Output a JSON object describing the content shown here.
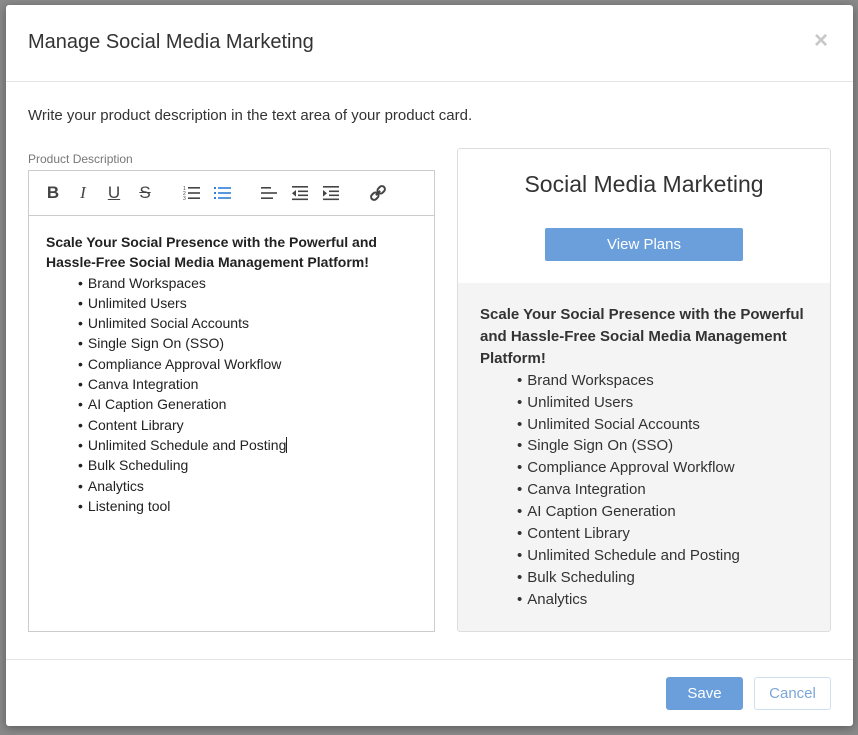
{
  "modal": {
    "title": "Manage Social Media Marketing",
    "close_glyph": "×",
    "intro": "Write your product description in the text area of your product card."
  },
  "editor": {
    "label": "Product Description",
    "toolbar": [
      {
        "name": "bold-button",
        "icon": "bold-icon",
        "glyph": "B"
      },
      {
        "name": "italic-button",
        "icon": "italic-icon",
        "glyph": "I"
      },
      {
        "name": "underline-button",
        "icon": "underline-icon",
        "glyph": "U"
      },
      {
        "name": "strikethrough-button",
        "icon": "strikethrough-icon",
        "glyph": "S"
      },
      {
        "name": "ordered-list-button",
        "icon": "ordered-list-icon"
      },
      {
        "name": "bullet-list-button",
        "icon": "bullet-list-icon",
        "active": true
      },
      {
        "name": "align-left-button",
        "icon": "align-left-icon"
      },
      {
        "name": "outdent-button",
        "icon": "outdent-icon"
      },
      {
        "name": "indent-button",
        "icon": "indent-icon"
      },
      {
        "name": "link-button",
        "icon": "link-icon"
      }
    ],
    "headline": "Scale Your Social Presence with the Powerful and Hassle-Free Social Media Management Platform!",
    "items": [
      "Brand Workspaces",
      "Unlimited Users",
      "Unlimited Social Accounts",
      "Single Sign On (SSO)",
      "Compliance Approval Workflow",
      "Canva Integration",
      "AI Caption Generation",
      "Content Library",
      "Unlimited Schedule and Posting",
      "Bulk Scheduling",
      "Analytics",
      "Listening tool"
    ]
  },
  "preview": {
    "title": "Social Media Marketing",
    "button_label": "View Plans",
    "headline": "Scale Your Social Presence with the Powerful and Hassle-Free Social Media Management Platform!",
    "items": [
      "Brand Workspaces",
      "Unlimited Users",
      "Unlimited Social Accounts",
      "Single Sign On (SSO)",
      "Compliance Approval Workflow",
      "Canva Integration",
      "AI Caption Generation",
      "Content Library",
      "Unlimited Schedule and Posting",
      "Bulk Scheduling",
      "Analytics"
    ]
  },
  "footer": {
    "save_label": "Save",
    "cancel_label": "Cancel"
  },
  "colors": {
    "accent": "#6a9fdb",
    "active_icon": "#2f7fd6",
    "preview_bg": "#f4f4f4"
  }
}
